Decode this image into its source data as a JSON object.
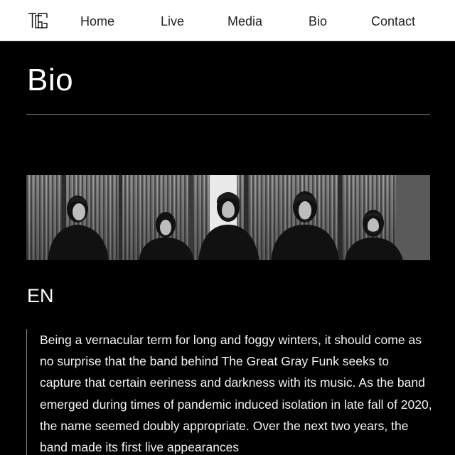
{
  "nav": {
    "logo_text": "TGG",
    "items": [
      "Home",
      "Live",
      "Media",
      "Bio",
      "Contact"
    ]
  },
  "page": {
    "title": "Bio",
    "language_heading": "EN"
  },
  "bio": {
    "text": "Being a vernacular term for long and foggy winters, it should come as no surprise that the band behind The Great Gray Funk seeks to capture that certain eeriness and darkness with its music. As the band emerged during times of pandemic induced isolation in late fall of 2020, the name seemed doubly appropriate. Over the next two years, the band made its first live appearances"
  },
  "photo": {
    "description_icon": "band-photo",
    "members": 5
  },
  "colors": {
    "background": "#000000",
    "nav_background": "#ffffff",
    "text": "#ffffff",
    "rule": "#8a8a8a"
  }
}
